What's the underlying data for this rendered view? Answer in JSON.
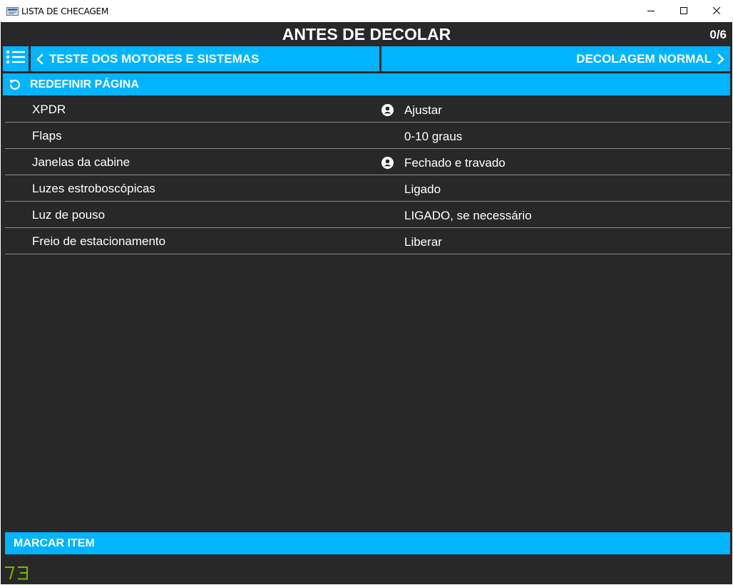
{
  "window": {
    "title": "LISTA DE CHECAGEM",
    "icon": "app-checklist-icon",
    "controls": [
      "minimize-icon",
      "maximize-icon",
      "close-icon"
    ]
  },
  "header": {
    "title": "ANTES DE DECOLAR",
    "progress": "0/6"
  },
  "nav": {
    "menu_icon": "list-menu-icon",
    "prev_label": "TESTE DOS MOTORES E SISTEMAS",
    "next_label": "DECOLAGEM NORMAL"
  },
  "reset": {
    "label": "REDEFINIR PÁGINA",
    "icon": "reset-icon"
  },
  "checklist": {
    "items": [
      {
        "label": "XPDR",
        "value": "Ajustar",
        "icon": "person-icon"
      },
      {
        "label": "Flaps",
        "value": "0-10 graus",
        "icon": ""
      },
      {
        "label": "Janelas da cabine",
        "value": "Fechado e travado",
        "icon": "person-icon"
      },
      {
        "label": "Luzes estroboscópicas",
        "value": "Ligado",
        "icon": ""
      },
      {
        "label": "Luz de pouso",
        "value": "LIGADO, se necessário",
        "icon": ""
      },
      {
        "label": "Freio de estacionamento",
        "value": "Liberar",
        "icon": ""
      }
    ]
  },
  "footer": {
    "mark_label": "MARCAR ITEM"
  },
  "colors": {
    "accent": "#00b4ff",
    "background": "#282828",
    "divider": "#8a8a8a",
    "logo": "#7cb800"
  }
}
